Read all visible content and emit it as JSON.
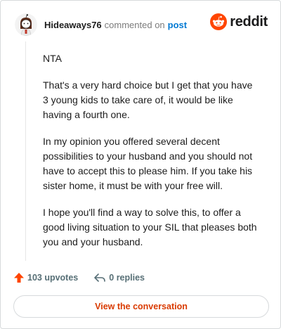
{
  "comment": {
    "username": "Hideaways76",
    "commented_on": "commented on",
    "post_link": "post",
    "paragraphs": [
      "NTA",
      "That's a very hard choice but I get that you have 3 young kids to take care of, it would be like having a fourth one.",
      "In my opinion you offered several decent possibilities to your husband and you should not have to accept this to please him. If you take his sister home, it must be with your free will.",
      "I hope you'll find a way to solve this, to offer a good living situation to your SIL that pleases both you and your husband."
    ]
  },
  "brand": {
    "name": "reddit",
    "color": "#ff4500"
  },
  "actions": {
    "upvotes_label": "103 upvotes",
    "replies_label": "0 replies"
  },
  "cta": {
    "label": "View the conversation"
  },
  "icons": {
    "avatar": "avatar-icon",
    "upvote": "upvote-arrow-icon",
    "reply": "reply-arrow-icon",
    "logo": "reddit-snoo-icon"
  },
  "colors": {
    "upvote": "#ff4500",
    "link": "#0079d3",
    "cta_text": "#d93a00"
  }
}
